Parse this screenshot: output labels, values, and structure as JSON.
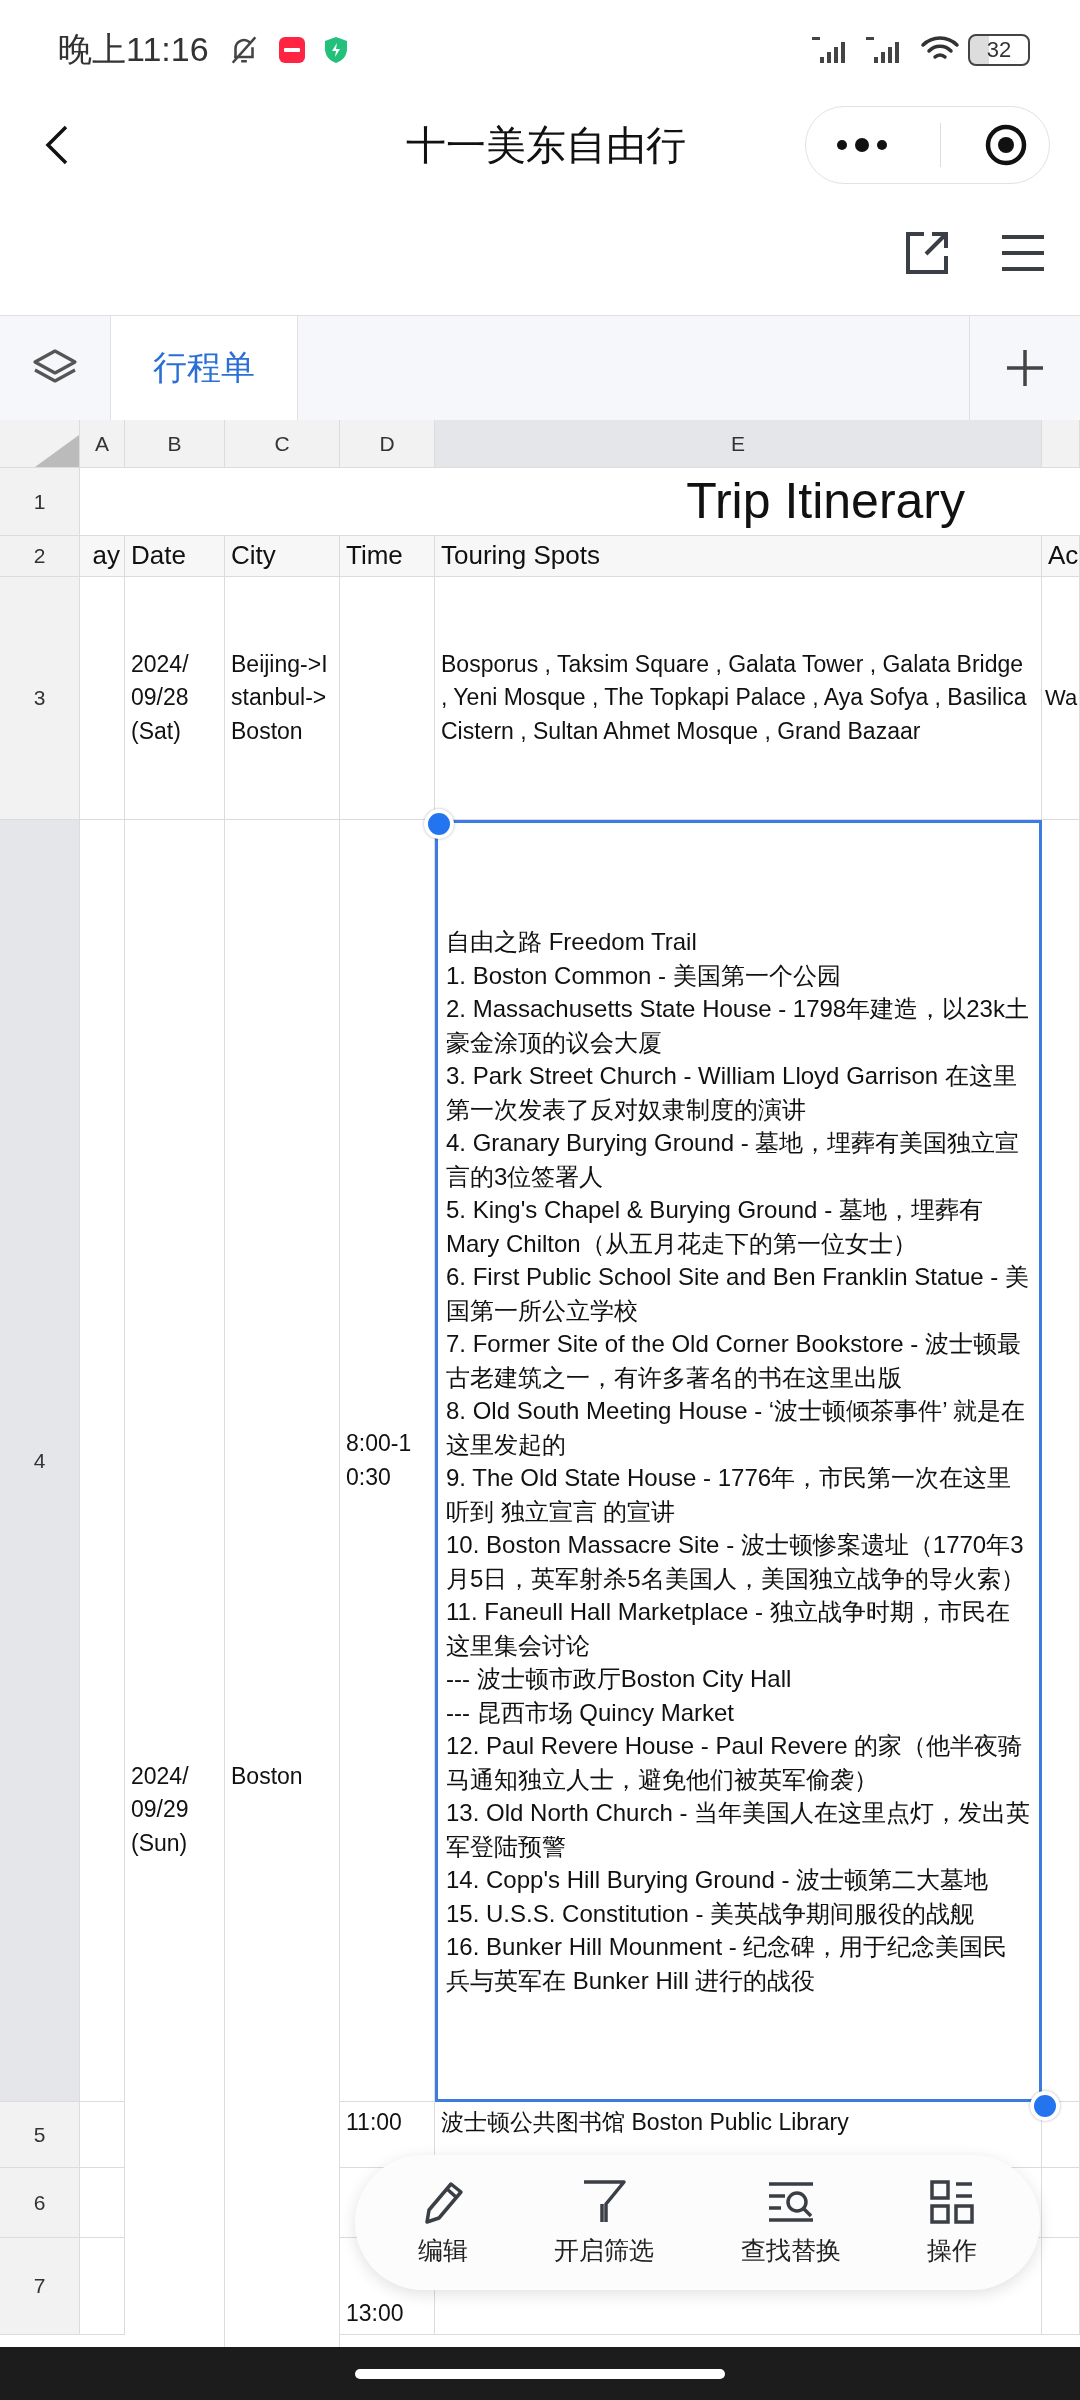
{
  "status_bar": {
    "time": "晚上11:16",
    "battery": "32"
  },
  "nav": {
    "title": "十一美东自由行"
  },
  "sheet_tabs": [
    {
      "label": "行程单",
      "selected": true
    }
  ],
  "columns": [
    {
      "label": "A",
      "selected": false
    },
    {
      "label": "B",
      "selected": false
    },
    {
      "label": "C",
      "selected": false
    },
    {
      "label": "D",
      "selected": false
    },
    {
      "label": "E",
      "selected": true
    }
  ],
  "row_headers": [
    {
      "label": "1",
      "selected": false
    },
    {
      "label": "2",
      "selected": false
    },
    {
      "label": "3",
      "selected": false
    },
    {
      "label": "4",
      "selected": true
    }
  ],
  "title": "Trip Itinerary",
  "headers": [
    "ay",
    "Date",
    "City",
    "Time",
    "Touring Spots",
    "Ac"
  ],
  "row3": {
    "date": "2024/\n09/28\n(Sat)",
    "city": "Beijing->Istanbul->Boston",
    "spots": "Bosporus , Taksim Square , Galata Tower , Galata Bridge , Yeni Mosque , The Topkapi Palace , Aya Sofya , Basilica Cistern , Sultan Ahmet Mosque , Grand Bazaar",
    "extra": "Wa"
  },
  "row4": {
    "selected": true,
    "date": "2024/\n09/29\n(Sun)",
    "city": "Boston",
    "time": "8:00-10:30",
    "spots": [
      "自由之路 Freedom Trail",
      "1. Boston Common - 美国第一个公园",
      "2.  Massachusetts State House - 1798年建造，以23k土豪金涂顶的议会大厦",
      "3. Park Street Church - William Lloyd Garrison 在这里第一次发表了反对奴隶制度的演讲",
      "4. Granary Burying Ground - 墓地，埋葬有美国独立宣言的3位签署人",
      "5. King's Chapel & Burying Ground - 墓地，埋葬有Mary Chilton（从五月花走下的第一位女士）",
      "6. First Public School Site and Ben Franklin Statue - 美国第一所公立学校",
      "7.  Former Site of the Old Corner Bookstore - 波士顿最古老建筑之一，有许多著名的书在这里出版",
      "8. Old South Meeting House - ‘波士顿倾茶事件’ 就是在这里发起的",
      "9. The Old State House - 1776年，市民第一次在这里听到 独立宣言 的宣讲",
      "10.  Boston Massacre Site - 波士顿惨案遗址（1770年3月5日，英军射杀5名美国人，美国独立战争的导火索）",
      "11. Faneull Hall Marketplace - 独立战争时期，市民在这里集会讨论",
      "--- 波士顿市政厅Boston City Hall",
      "--- 昆西市场 Quincy Market",
      "12. Paul Revere House - Paul Revere 的家（他半夜骑马通知独立人士，避免他们被英军偷袭）",
      "13. Old North Church - 当年美国人在这里点灯，发出英军登陆预警",
      "14. Copp's Hill Burying Ground - 波士顿第二大墓地",
      "15. U.S.S. Constitution - 美英战争期间服役的战舰",
      "16. Bunker Hill Mounment - 纪念碑，用于纪念美国民兵与英军在 Bunker Hill 进行的战役"
    ]
  },
  "later_rows": [
    {
      "header": "5",
      "time": "11:00",
      "spots": "波士顿公共图书馆 Boston Public Library"
    },
    {
      "header": "6"
    },
    {
      "header": "7",
      "time": "13:00"
    }
  ],
  "toolbar": [
    {
      "label": "编辑",
      "kind": "pencil"
    },
    {
      "label": "开启筛选",
      "kind": "filter"
    },
    {
      "label": "查找替换",
      "kind": "find"
    },
    {
      "label": "操作",
      "kind": "grid"
    }
  ]
}
